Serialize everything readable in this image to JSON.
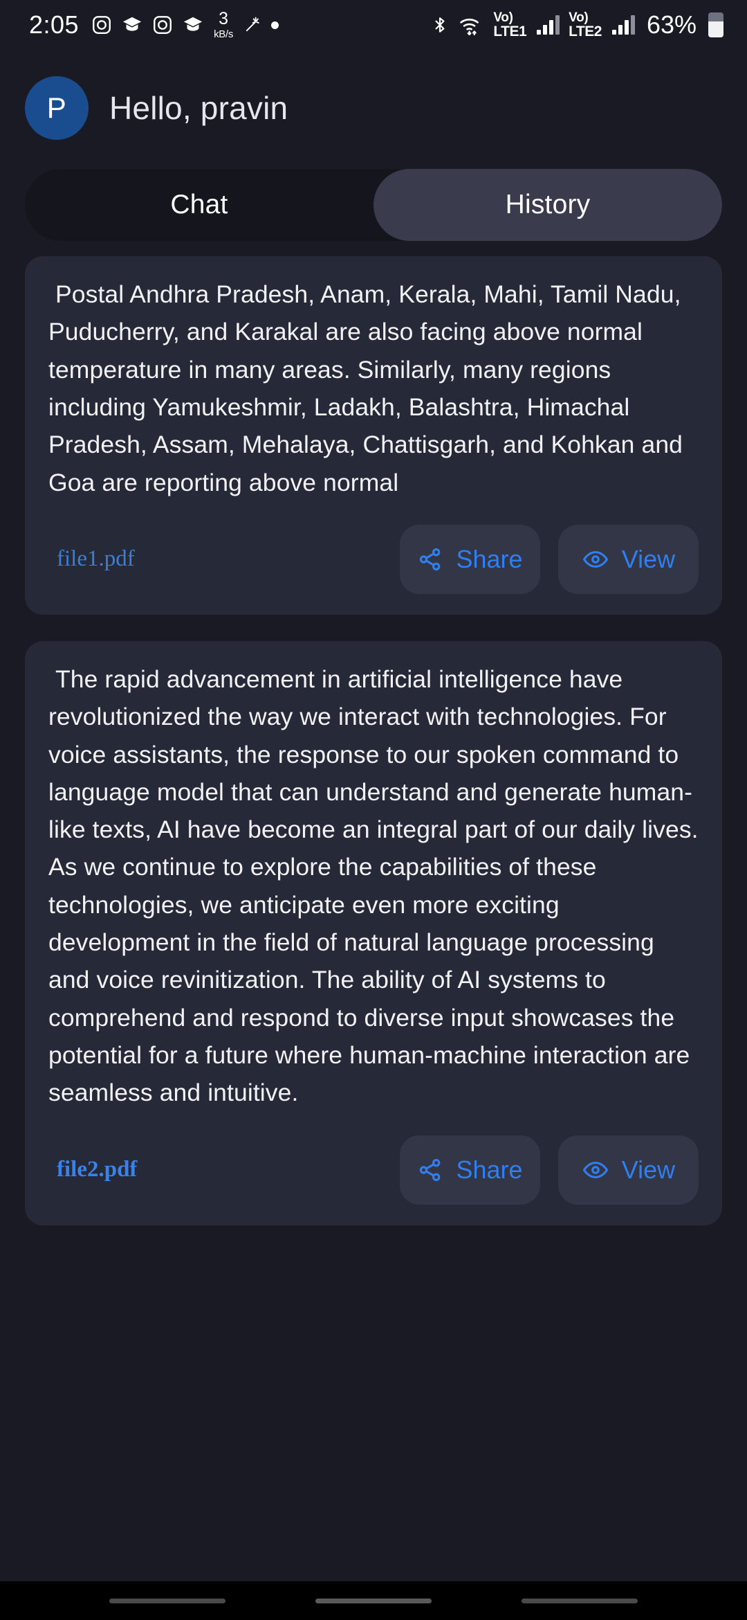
{
  "status_bar": {
    "time": "2:05",
    "left_icons": [
      "instagram-icon",
      "graduation-cap-icon",
      "instagram-icon",
      "graduation-cap-icon"
    ],
    "net_speed_value": "3",
    "net_speed_unit": "kB/s",
    "extra_icons": [
      "sparkle-icon",
      "dot-icon"
    ],
    "right_icons": [
      "bluetooth-icon",
      "wifi-icon"
    ],
    "sim1_label_vo": "Vo)",
    "sim1_label_lte": "LTE1",
    "sim2_label_vo": "Vo)",
    "sim2_label_lte": "LTE2",
    "battery_percent": "63%"
  },
  "header": {
    "avatar_initial": "P",
    "greeting": "Hello, pravin",
    "avatar_color": "#1a4d8f"
  },
  "tabs": [
    {
      "label": "Chat",
      "active": false
    },
    {
      "label": "History",
      "active": true
    }
  ],
  "accent_color": "#2f7ff0",
  "actions": {
    "share_label": "Share",
    "view_label": "View"
  },
  "cards": [
    {
      "text": " Postal Andhra Pradesh, Anam, Kerala, Mahi, Tamil Nadu, Puducherry, and Karakal are also facing above normal temperature in many areas. Similarly, many regions including Yamukeshmir, Ladakh, Balashtra, Himachal Pradesh, Assam, Mehalaya, Chattisgarh, and Kohkan and Goa are reporting above normal",
      "filename": "file1.pdf",
      "filename_bold": false
    },
    {
      "text": " The rapid advancement in artificial intelligence have revolutionized the way we interact with technologies. For voice assistants, the response to our spoken command to language model that can understand and generate human-like texts, AI have become an integral part of our daily lives. As we continue to explore the capabilities of these technologies, we anticipate even more exciting development in the field of natural language processing and voice revinitization. The ability of AI systems to comprehend and respond to diverse input showcases the potential for a future where human-machine interaction are seamless and intuitive.",
      "filename": "file2.pdf",
      "filename_bold": true
    }
  ]
}
